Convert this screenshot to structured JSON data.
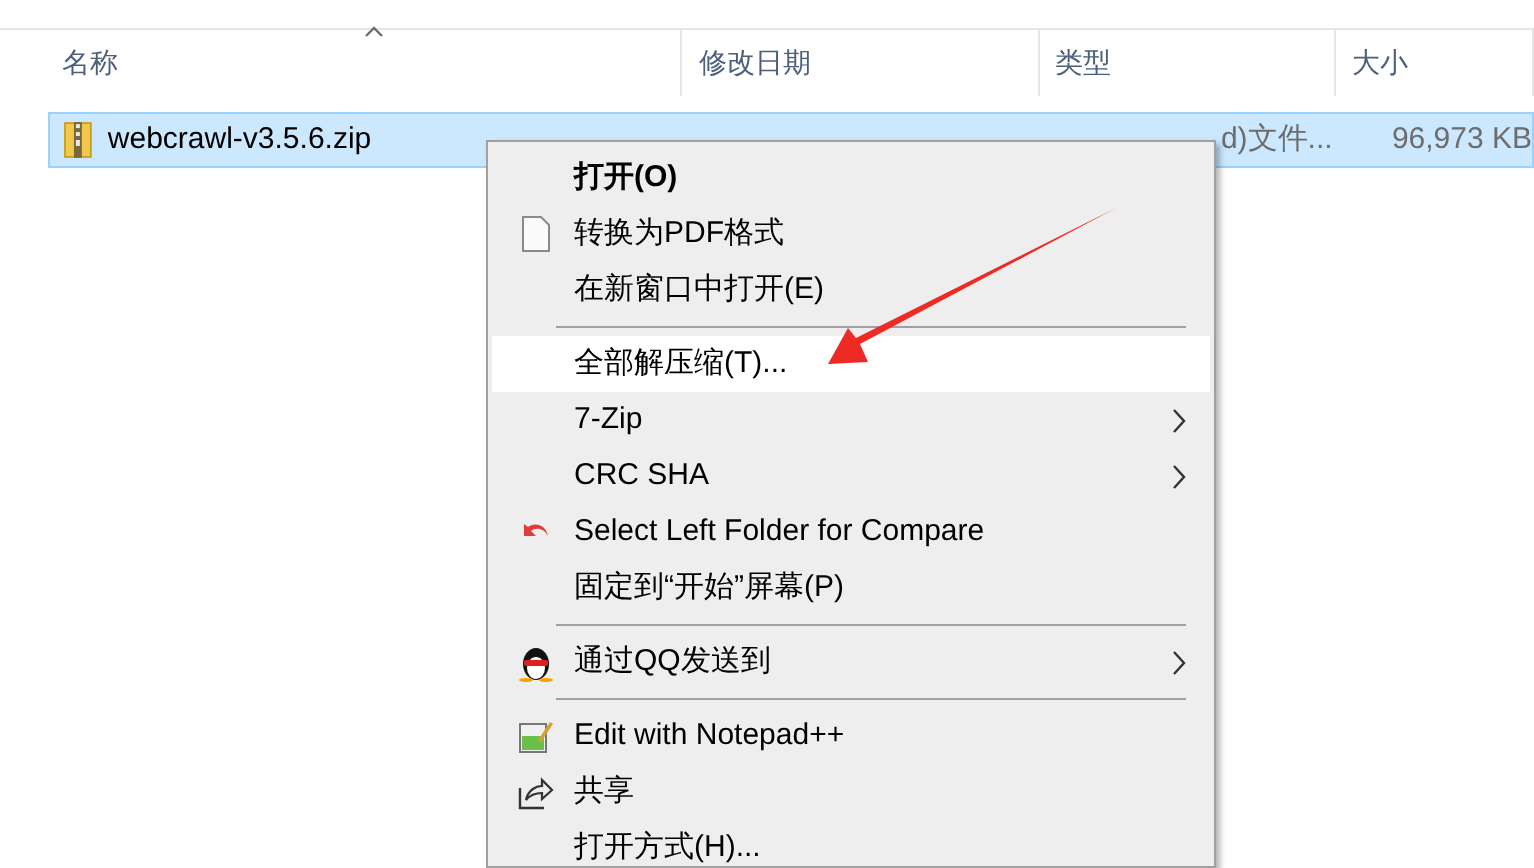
{
  "columns": [
    {
      "label": "名称",
      "sorted": true
    },
    {
      "label": "修改日期",
      "sorted": false
    },
    {
      "label": "类型",
      "sorted": false
    },
    {
      "label": "大小",
      "sorted": false
    }
  ],
  "files": [
    {
      "name": "webcrawl-v3.5.6.zip",
      "type": "d)文件...",
      "size": "96,973 KB",
      "selected": true
    }
  ],
  "context_menu": {
    "items": [
      {
        "kind": "item",
        "label": "打开(O)",
        "default": true,
        "highlighted": false,
        "submenu": false
      },
      {
        "kind": "item",
        "label": "转换为PDF格式",
        "default": false,
        "highlighted": false,
        "submenu": false
      },
      {
        "kind": "item",
        "label": "在新窗口中打开(E)",
        "default": false,
        "highlighted": false,
        "submenu": false
      },
      {
        "kind": "separator"
      },
      {
        "kind": "item",
        "label": "全部解压缩(T)...",
        "default": false,
        "highlighted": true,
        "submenu": false
      },
      {
        "kind": "item",
        "label": "7-Zip",
        "default": false,
        "highlighted": false,
        "submenu": true
      },
      {
        "kind": "item",
        "label": "CRC SHA",
        "default": false,
        "highlighted": false,
        "submenu": true
      },
      {
        "kind": "item",
        "label": "Select Left Folder for Compare",
        "default": false,
        "highlighted": false,
        "submenu": false
      },
      {
        "kind": "item",
        "label": "固定到“开始”屏幕(P)",
        "default": false,
        "highlighted": false,
        "submenu": false
      },
      {
        "kind": "separator"
      },
      {
        "kind": "item",
        "label": "通过QQ发送到",
        "default": false,
        "highlighted": false,
        "submenu": true
      },
      {
        "kind": "separator"
      },
      {
        "kind": "item",
        "label": "Edit with Notepad++",
        "default": false,
        "highlighted": false,
        "submenu": false
      },
      {
        "kind": "item",
        "label": "共享",
        "default": false,
        "highlighted": false,
        "submenu": false
      },
      {
        "kind": "item",
        "label": "打开方式(H)...",
        "default": false,
        "highlighted": false,
        "submenu": false
      }
    ]
  }
}
